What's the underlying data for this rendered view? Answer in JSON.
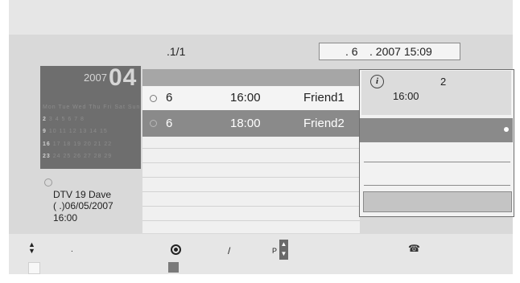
{
  "header": {
    "page_indicator": ".1/1",
    "date_day": ". 6",
    "date_rest": ". 2007 15:09"
  },
  "calendar": {
    "year": "2007",
    "month": "04",
    "weekday_headers": "Mon Tue Wed Thu Fri Sat Sun",
    "weeks": [
      {
        "week": "2",
        "days": "3 4 5 6 7 8"
      },
      {
        "week": "9",
        "days": "10 11 12 13 14 15"
      },
      {
        "week": "16",
        "days": "17 18 19 20 21 22"
      },
      {
        "week": "23",
        "days": "24 25 26 27 28 29"
      }
    ]
  },
  "channel": {
    "name": "DTV 19 Dave",
    "date": "(    .)06/05/2007",
    "time": "16:00"
  },
  "schedule": {
    "rows": [
      {
        "day": "6",
        "time": "16:00",
        "title": "Friend1",
        "selected": false
      },
      {
        "day": "6",
        "time": "18:00",
        "title": "Friend2",
        "selected": true
      }
    ]
  },
  "popup": {
    "info_icon": "i",
    "count": "2",
    "time": "16:00"
  },
  "footer": {
    "nav_arrows_icon": "up-down-arrows",
    "nav_label": ".",
    "record_icon": "record",
    "slash": "/",
    "p_label": "P",
    "p_up": "^",
    "p_down": "v",
    "phone_icon": "phone"
  },
  "colors": {
    "panel": "#d9d9d9",
    "selected_row": "#8a8a8a",
    "calendar_bg": "#6e6e6e"
  }
}
